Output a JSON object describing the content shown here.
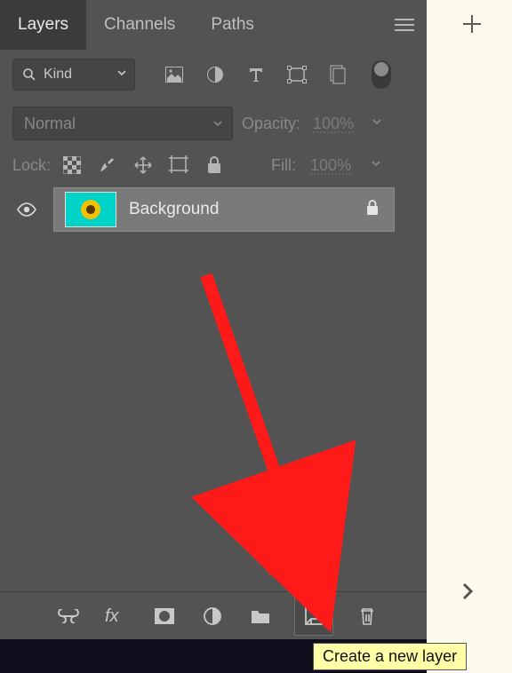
{
  "tabs": {
    "layers": "Layers",
    "channels": "Channels",
    "paths": "Paths"
  },
  "filter": {
    "kind": "Kind"
  },
  "blend": {
    "mode": "Normal",
    "opacity_label": "Opacity:",
    "opacity_value": "100%"
  },
  "lock": {
    "label": "Lock:",
    "fill_label": "Fill:",
    "fill_value": "100%"
  },
  "layers": [
    {
      "name": "Background"
    }
  ],
  "tooltip": "Create a new layer"
}
